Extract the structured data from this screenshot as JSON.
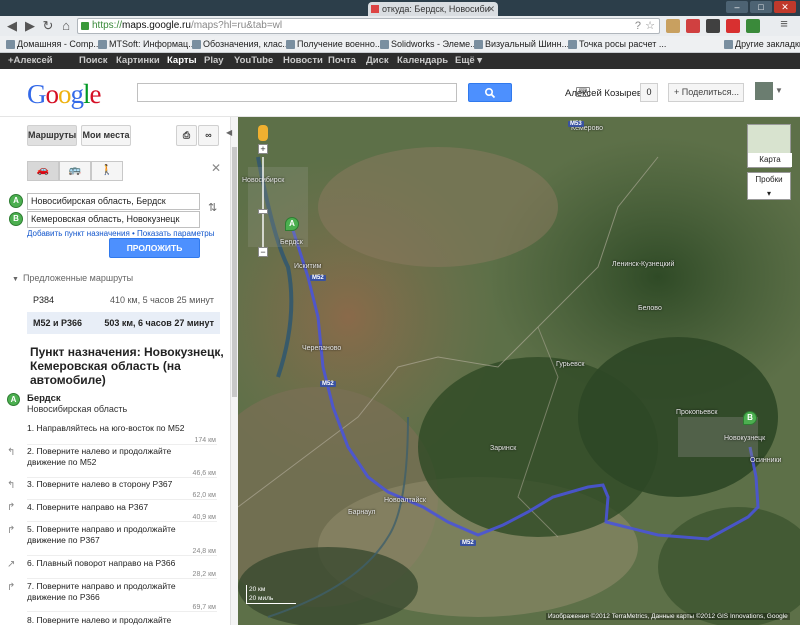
{
  "browser": {
    "tab_title": "откуда: Бердск, Новосиби",
    "url_scheme": "https://",
    "url_host": "maps.google.ru",
    "url_path": "/maps?hl=ru&tab=wl",
    "bookmarks": [
      "Домашняя - Comp...",
      "MTSoft: Информац...",
      "Обозначения, клас...",
      "Получение военно...",
      "Solidworks - Элеме...",
      "Визуальный Шинн...",
      "Точка росы расчет ..."
    ],
    "other_bookmarks": "Другие закладки"
  },
  "gbar": {
    "items": [
      "+Алексей",
      "Поиск",
      "Картинки",
      "Карты",
      "Play",
      "YouTube",
      "Новости",
      "Почта",
      "Диск",
      "Календарь",
      "Ещё ▾"
    ],
    "active": "Карты"
  },
  "header": {
    "logo": "Google",
    "user_name": "Алексей Козырев",
    "notifications": "0",
    "share_label": "+ Поделиться..."
  },
  "panel": {
    "tab_routes": "Маршруты",
    "tab_my_places": "Мои места",
    "from_marker": "A",
    "to_marker": "B",
    "from_value": "Новосибирская область, Бердск",
    "to_value": "Кемеровская область, Новокузнецк",
    "link_add": "Добавить пункт назначения",
    "link_sep": " • ",
    "link_params": "Показать параметры",
    "route_button": "ПРОЛОЖИТЬ МАРШРУТ",
    "suggested_title": "Предложенные маршруты",
    "routes": [
      {
        "name": "Р384",
        "info": "410 км, 5 часов 25 минут"
      },
      {
        "name": "М52 и Р366",
        "info": "503 км, 6 часов 27 минут"
      }
    ],
    "destination_title": "Пункт назначения: Новокузнецк, Кемеровская область (на автомобиле)",
    "start_marker": "A",
    "start_name": "Бердск",
    "start_region": "Новосибирская область",
    "steps": [
      {
        "text": "1. Направляйтесь на юго-восток по М52",
        "dist": "174 км"
      },
      {
        "text": "2. Поверните налево и продолжайте движение по М52",
        "dist": "46,6 км"
      },
      {
        "text": "3. Поверните налево в сторону Р367",
        "dist": "62,0 км"
      },
      {
        "text": "4. Поверните направо на Р367",
        "dist": "40,9 км"
      },
      {
        "text": "5. Поверните направо и продолжайте движение по Р367",
        "dist": "24,8 км"
      },
      {
        "text": "6. Плавный поворот направо на Р366",
        "dist": "28,2 км"
      },
      {
        "text": "7. Поверните направо и продолжайте движение по Р366",
        "dist": "69,7 км"
      },
      {
        "text": "8. Поверните налево и продолжайте",
        "dist": ""
      }
    ]
  },
  "map": {
    "maptype_label": "Карта",
    "traffic_label": "Пробки",
    "labels": [
      "Кемерово",
      "Новосибирск",
      "Искитим",
      "Черепаново",
      "Прокопьевск",
      "Новокузнецк",
      "Новоалтайск",
      "Барнаул",
      "Белово",
      "Гурьевск",
      "Заринск",
      "Осинники",
      "Ленинск-Кузнецкий",
      "Бердск"
    ],
    "shields": [
      "M52",
      "M52",
      "M52",
      "M53"
    ],
    "marker_a": "A",
    "marker_b": "B",
    "scale_km": "20 км",
    "scale_mi": "20 миль",
    "copyright": "Изображения ©2012 TerraMetrics, Данные карты ©2012 GIS Innovations, Google",
    "route_color": "#4a54d8"
  }
}
